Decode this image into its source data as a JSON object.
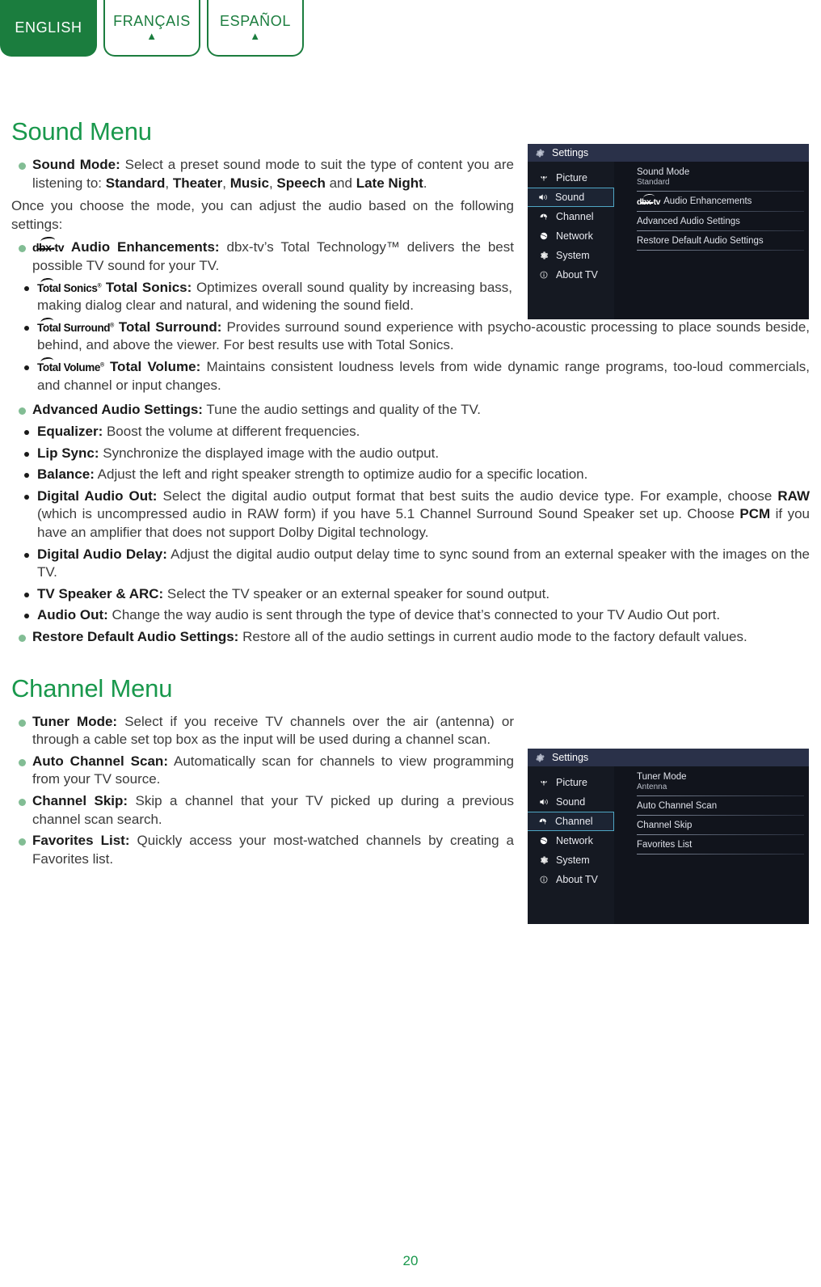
{
  "languages": [
    {
      "label": "ENGLISH",
      "active": true,
      "arrow": ""
    },
    {
      "label": "FRANÇAIS",
      "active": false,
      "arrow": "▲"
    },
    {
      "label": "ESPAÑOL",
      "active": false,
      "arrow": "▲"
    }
  ],
  "sound_section": {
    "title": "Sound Menu",
    "sound_mode": {
      "term": "Sound Mode:",
      "text_a": " Select a preset sound mode to suit the type of content you are listening to: ",
      "opt1": "Standard",
      "sep1": ", ",
      "opt2": "Theater",
      "sep2": ", ",
      "opt3": "Music",
      "sep3": ", ",
      "opt4": "Speech",
      "sep4": " and ",
      "opt5": "Late Night",
      "end": "."
    },
    "intro_paragraph": "Once you choose the mode, you can adjust the audio based on the following settings:",
    "audio_enhancements": {
      "logo": "dbx-tv",
      "term": "Audio Enhancements:",
      "text": " dbx-tv’s Total Technology™ delivers the best possible TV sound for your TV."
    },
    "sub_items": [
      {
        "logo": "Total Sonics",
        "term": "Total Sonics:",
        "text": " Optimizes overall sound quality by increasing bass, making dialog clear and natural, and widening the sound field."
      },
      {
        "logo": "Total Surround",
        "term": "Total Surround:",
        "text": " Provides surround sound experience with psycho-acoustic processing to place sounds beside, behind, and above the viewer. For best results use with Total Sonics."
      },
      {
        "logo": "Total Volume",
        "term": "Total Volume:",
        "text": " Maintains consistent loudness levels from wide dynamic range programs, too-loud commercials, and channel or input changes."
      }
    ],
    "advanced": {
      "term": "Advanced Audio Settings:",
      "text": " Tune the audio settings and quality of the TV."
    },
    "advanced_items": [
      {
        "term": "Equalizer:",
        "text": " Boost the volume at different frequencies."
      },
      {
        "term": "Lip Sync:",
        "text": " Synchronize the displayed image with the audio output."
      },
      {
        "term": "Balance:",
        "text": " Adjust the left and right speaker strength to optimize audio for a specific location."
      },
      {
        "term": "Digital Audio Out:",
        "text_a": " Select the digital audio output format that best suits the audio device type. For example, choose ",
        "bold_a": "RAW",
        "text_b": " (which is uncompressed audio in RAW form) if you have 5.1 Channel Surround Sound Speaker set up. Choose ",
        "bold_b": "PCM",
        "text_c": " if you have an amplifier that does not support Dolby Digital technology."
      },
      {
        "term": "Digital Audio Delay:",
        "text": " Adjust the digital audio output delay time to sync sound from an external speaker with the images on the TV."
      },
      {
        "term": "TV Speaker & ARC:",
        "text": " Select the TV speaker or an external speaker for sound output."
      },
      {
        "term": "Audio Out:",
        "text": " Change the way audio is sent through the type of device that’s connected to your TV Audio Out port."
      }
    ],
    "restore": {
      "term": "Restore Default Audio Settings:",
      "text": " Restore all of the audio settings in current audio mode to the factory default values."
    }
  },
  "channel_section": {
    "title": "Channel Menu",
    "items": [
      {
        "term": "Tuner Mode:",
        "text": " Select if you receive TV channels over the air (antenna) or through a cable set top box as the input will be used during a channel scan."
      },
      {
        "term": "Auto Channel Scan:",
        "text": " Automatically scan for channels to view programming from your TV source."
      },
      {
        "term": "Channel Skip:",
        "text": " Skip a channel that your TV picked up during a previous channel scan search."
      },
      {
        "term": "Favorites List:",
        "text": " Quickly access your most-watched channels by creating a Favorites list."
      }
    ]
  },
  "tv_menu_sound": {
    "header_title": "Settings",
    "sidebar": [
      {
        "label": "Picture",
        "icon": "picture-icon",
        "selected": false
      },
      {
        "label": "Sound",
        "icon": "speaker-icon",
        "selected": true
      },
      {
        "label": "Channel",
        "icon": "antenna-icon",
        "selected": false
      },
      {
        "label": "Network",
        "icon": "globe-icon",
        "selected": false
      },
      {
        "label": "System",
        "icon": "gear-icon",
        "selected": false
      },
      {
        "label": "About TV",
        "icon": "info-icon",
        "selected": false
      }
    ],
    "rows": [
      {
        "label": "Sound Mode",
        "value": "Standard",
        "logo": ""
      },
      {
        "label": "Audio Enhancements",
        "value": "",
        "logo": "dbx-tv"
      },
      {
        "label": "Advanced Audio Settings",
        "value": "",
        "logo": ""
      },
      {
        "label": "Restore Default Audio Settings",
        "value": "",
        "logo": ""
      }
    ]
  },
  "tv_menu_channel": {
    "header_title": "Settings",
    "sidebar": [
      {
        "label": "Picture",
        "icon": "picture-icon",
        "selected": false
      },
      {
        "label": "Sound",
        "icon": "speaker-icon",
        "selected": false
      },
      {
        "label": "Channel",
        "icon": "antenna-icon",
        "selected": true
      },
      {
        "label": "Network",
        "icon": "globe-icon",
        "selected": false
      },
      {
        "label": "System",
        "icon": "gear-icon",
        "selected": false
      },
      {
        "label": "About TV",
        "icon": "info-icon",
        "selected": false
      }
    ],
    "rows": [
      {
        "label": "Tuner Mode",
        "value": "Antenna",
        "logo": ""
      },
      {
        "label": "Auto Channel Scan",
        "value": "",
        "logo": ""
      },
      {
        "label": "Channel Skip",
        "value": "",
        "logo": ""
      },
      {
        "label": "Favorites List",
        "value": "",
        "logo": ""
      }
    ]
  },
  "footer": {
    "page_number": "20"
  },
  "colors": {
    "brand_green": "#19984c",
    "tab_green": "#1b7d3e",
    "bullet_green": "#82bd94",
    "menu_bg": "#11141c",
    "menu_header": "#2a3149",
    "menu_highlight": "#4fa6c4"
  }
}
